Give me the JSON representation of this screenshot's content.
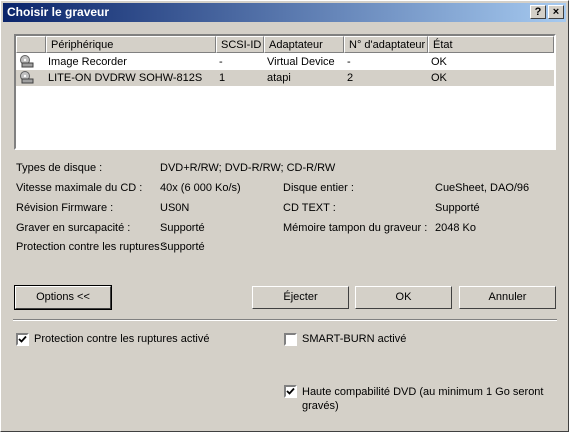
{
  "window": {
    "title": "Choisir le graveur"
  },
  "titlebar": {
    "help": "?",
    "close": "×"
  },
  "list": {
    "headers": [
      "Périphérique",
      "SCSI-ID",
      "Adaptateur",
      "N° d'adaptateur",
      "État"
    ],
    "rows": [
      {
        "device": "Image Recorder",
        "scsi_id": "-",
        "adapter": "Virtual Device",
        "adapter_num": "-",
        "state": "OK"
      },
      {
        "device": "LITE-ON  DVDRW SOHW-812S",
        "scsi_id": "1",
        "adapter": "atapi",
        "adapter_num": "2",
        "state": "OK"
      }
    ]
  },
  "info": {
    "disc_types_label": "Types de disque :",
    "disc_types_value": "DVD+R/RW; DVD-R/RW; CD-R/RW",
    "max_speed_label": "Vitesse maximale du CD :",
    "max_speed_value": "40x (6 000 Ko/s)",
    "full_disc_label": "Disque entier :",
    "full_disc_value": "CueSheet, DAO/96",
    "firmware_label": "Révision Firmware :",
    "firmware_value": "US0N",
    "cdtext_label": "CD TEXT :",
    "cdtext_value": "Supporté",
    "overburn_label": "Graver en surcapacité :",
    "overburn_value": "Supporté",
    "buffer_label": "Mémoire tampon du graveur :",
    "buffer_value": "2048 Ko",
    "underrun_label": "Protection contre les ruptures :",
    "underrun_value": "Supporté"
  },
  "buttons": {
    "options": "Options <<",
    "eject": "Éjecter",
    "ok": "OK",
    "cancel": "Annuler"
  },
  "options": {
    "underrun_protection": {
      "label": "Protection contre les ruptures activé",
      "checked": true
    },
    "smart_burn": {
      "label": "SMART-BURN activé",
      "checked": false
    },
    "dvd_compat": {
      "label": "Haute compabilité DVD (au minimum 1 Go seront gravés)",
      "checked": true
    }
  }
}
